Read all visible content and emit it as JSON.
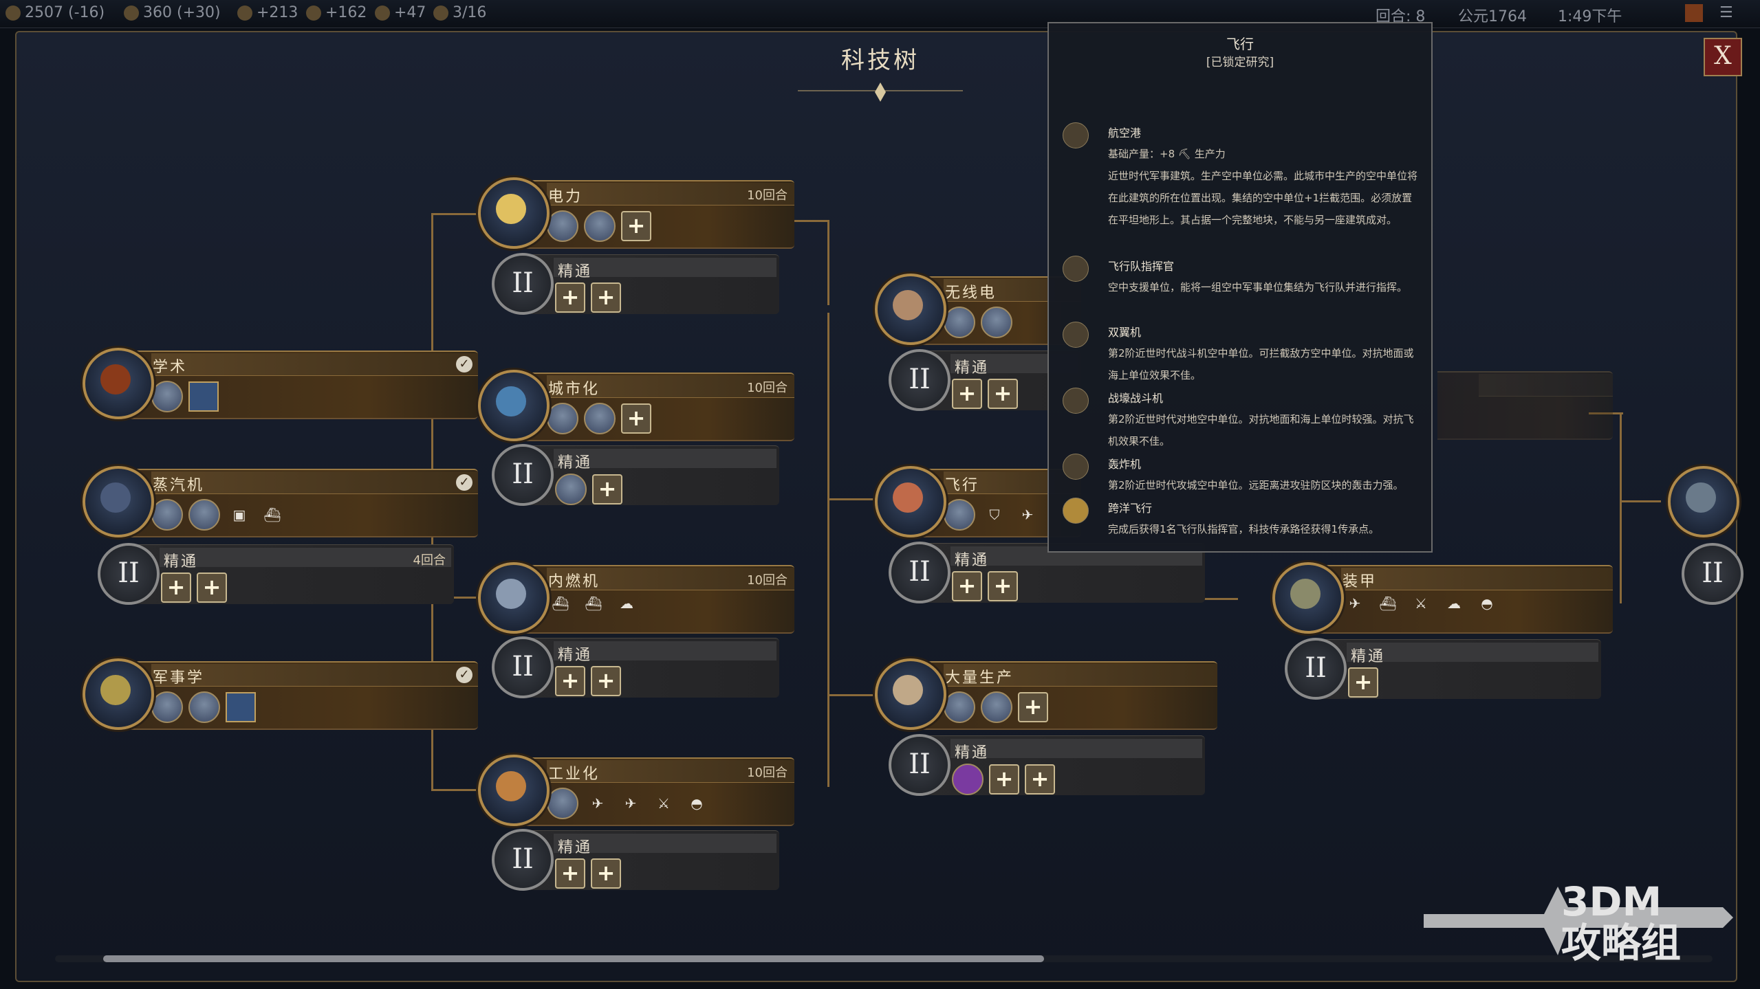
{
  "topbar": {
    "gold": "2507 (-16)",
    "science": "360 (+30)",
    "faith": "+213",
    "culture": "+162",
    "food": "+47",
    "cities": "3/16",
    "turn": "回合: 8",
    "year": "公元1764",
    "time": "1:49下午"
  },
  "window": {
    "title": "科技树",
    "close_label": "X"
  },
  "nodes": [
    {
      "id": "academia",
      "name": "学术",
      "turns": "",
      "researched": true
    },
    {
      "id": "steam",
      "name": "蒸汽机",
      "turns": "",
      "researched": true
    },
    {
      "id": "military",
      "name": "军事学",
      "turns": "",
      "researched": true
    },
    {
      "id": "electricity",
      "name": "电力",
      "turns": "10回合",
      "researched": false
    },
    {
      "id": "urbanization",
      "name": "城市化",
      "turns": "10回合",
      "researched": false
    },
    {
      "id": "combustion",
      "name": "内燃机",
      "turns": "10回合",
      "researched": false
    },
    {
      "id": "industrialization",
      "name": "工业化",
      "turns": "10回合",
      "researched": false
    },
    {
      "id": "radio",
      "name": "无线电",
      "turns": "",
      "researched": false
    },
    {
      "id": "flight",
      "name": "飞行",
      "turns": "",
      "researched": false
    },
    {
      "id": "massprod",
      "name": "大量生产",
      "turns": "",
      "researched": false
    },
    {
      "id": "armor",
      "name": "装甲",
      "turns": "",
      "researched": false
    }
  ],
  "mastery": {
    "label": "精通",
    "numeral": "II",
    "steam_turns": "4回合"
  },
  "tooltip": {
    "title": "飞行",
    "status": "[已锁定研究]",
    "entries": [
      {
        "icon": "airport-icon",
        "name": "航空港",
        "desc": "基础产量：+8 ⛏ 生产力\n近世时代军事建筑。生产空中单位必需。此城市中生产的空中单位将在此建筑的所在位置出现。集结的空中单位+1拦截范围。必须放置在平坦地形上。其占据一个完整地块，不能与另一座建筑成对。"
      },
      {
        "icon": "squadron-icon",
        "name": "飞行队指挥官",
        "desc": "空中支援单位，能将一组空中军事单位集结为飞行队并进行指挥。"
      },
      {
        "icon": "biplane-icon",
        "name": "双翼机",
        "desc": "第2阶近世时代战斗机空中单位。可拦截敌方空中单位。对抗地面或海上单位效果不佳。"
      },
      {
        "icon": "fighter-icon",
        "name": "战壕战斗机",
        "desc": "第2阶近世时代对地空中单位。对抗地面和海上单位时较强。对抗飞机效果不佳。"
      },
      {
        "icon": "bomber-icon",
        "name": "轰炸机",
        "desc": "第2阶近世时代攻城空中单位。远距离进攻驻防区块的轰击力强。"
      },
      {
        "icon": "transoceanic-icon",
        "name": "跨洋飞行",
        "desc": "完成后获得1名飞行队指挥官，科技传承路径获得1传承点。"
      }
    ]
  },
  "watermark": {
    "line1": "3DM",
    "line2": "攻略组"
  },
  "colors": {
    "gold": "#b08a4a",
    "panel": "#1a2130",
    "close": "#6a1a1a"
  }
}
